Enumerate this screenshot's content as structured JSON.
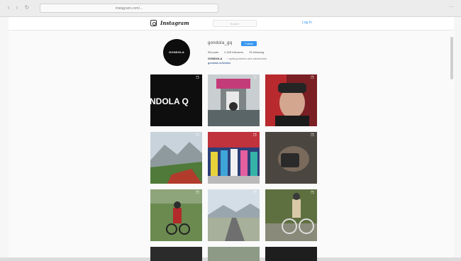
{
  "browser": {
    "url": "instagram.com/...",
    "back_glyph": "‹",
    "forward_glyph": "›",
    "reload_glyph": "↻",
    "right_glyph": "⋯"
  },
  "header": {
    "wordmark": "Instagram",
    "search_placeholder": "Search",
    "login_label": "Log In"
  },
  "profile": {
    "avatar_text": "GONDOLA",
    "username": "gondola_gq",
    "follow_label": "Follow",
    "stats": [
      {
        "label": "98 posts"
      },
      {
        "label": "2,345 followers"
      },
      {
        "label": "78 following"
      }
    ],
    "bio_name": "GONDOLA",
    "bio_text": "~ cycling stories and adventures",
    "bio_link": "gondola.cc/stories"
  },
  "grid": {
    "multi_icon": "❐",
    "tiles": [
      {
        "label": "NDOLA Q",
        "theme": "text-black"
      },
      {
        "label": "",
        "theme": "podium"
      },
      {
        "label": "",
        "theme": "portrait"
      },
      {
        "label": "",
        "theme": "mountain"
      },
      {
        "label": "",
        "theme": "celebration"
      },
      {
        "label": "",
        "theme": "dark-hand"
      },
      {
        "label": "",
        "theme": "grass-rider"
      },
      {
        "label": "",
        "theme": "snow-valley"
      },
      {
        "label": "",
        "theme": "cyclist"
      },
      {
        "label": "",
        "theme": "dark"
      },
      {
        "label": "",
        "theme": "landscape"
      },
      {
        "label": "",
        "theme": "dark"
      }
    ]
  }
}
